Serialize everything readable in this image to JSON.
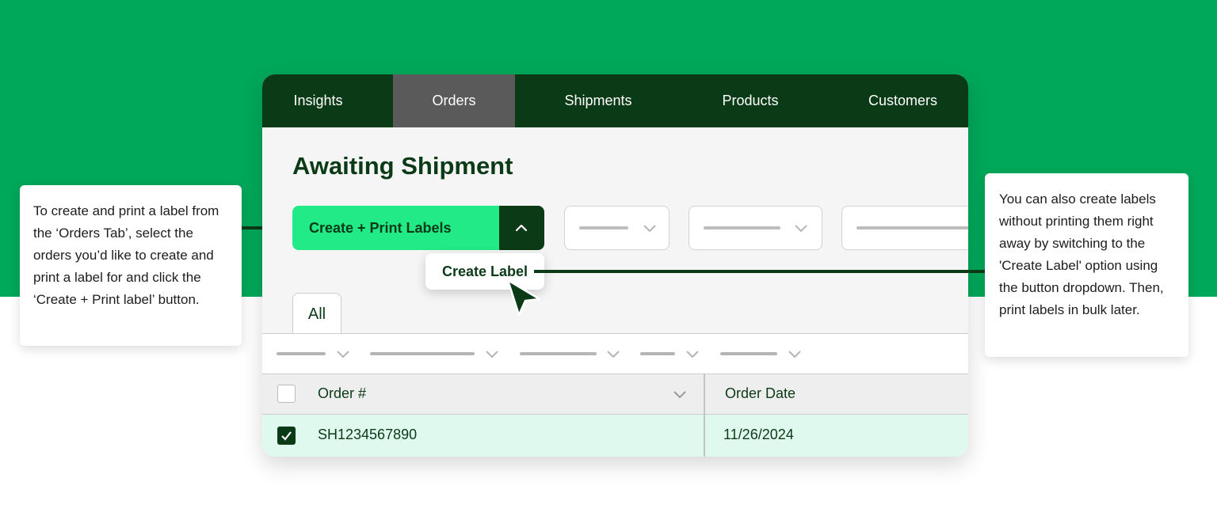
{
  "nav": {
    "tabs": [
      {
        "label": "Insights",
        "active": false
      },
      {
        "label": "Orders",
        "active": true
      },
      {
        "label": "Shipments",
        "active": false
      },
      {
        "label": "Products",
        "active": false
      },
      {
        "label": "Customers",
        "active": false
      }
    ]
  },
  "page": {
    "title": "Awaiting Shipment",
    "primary_button_label": "Create + Print Labels",
    "dropdown_option": "Create Label",
    "view_tab_label": "All"
  },
  "table": {
    "columns": [
      "Order #",
      "Order Date"
    ],
    "rows": [
      {
        "checked": true,
        "order_number": "SH1234567890",
        "order_date": "11/26/2024"
      }
    ]
  },
  "callouts": {
    "left": "To create and print a label from the ‘Orders Tab’, select the orders you’d like to create and print a label for and click the ‘Create + Print label’ button.",
    "right": "You can also create labels without printing them right away by switching to the 'Create Label' option using the button dropdown. Then, print labels in bulk later."
  },
  "colors": {
    "brand_green": "#00a859",
    "dark_green": "#0b3a17",
    "button_green": "#22ea86",
    "selected_row": "#e0f9ee"
  }
}
